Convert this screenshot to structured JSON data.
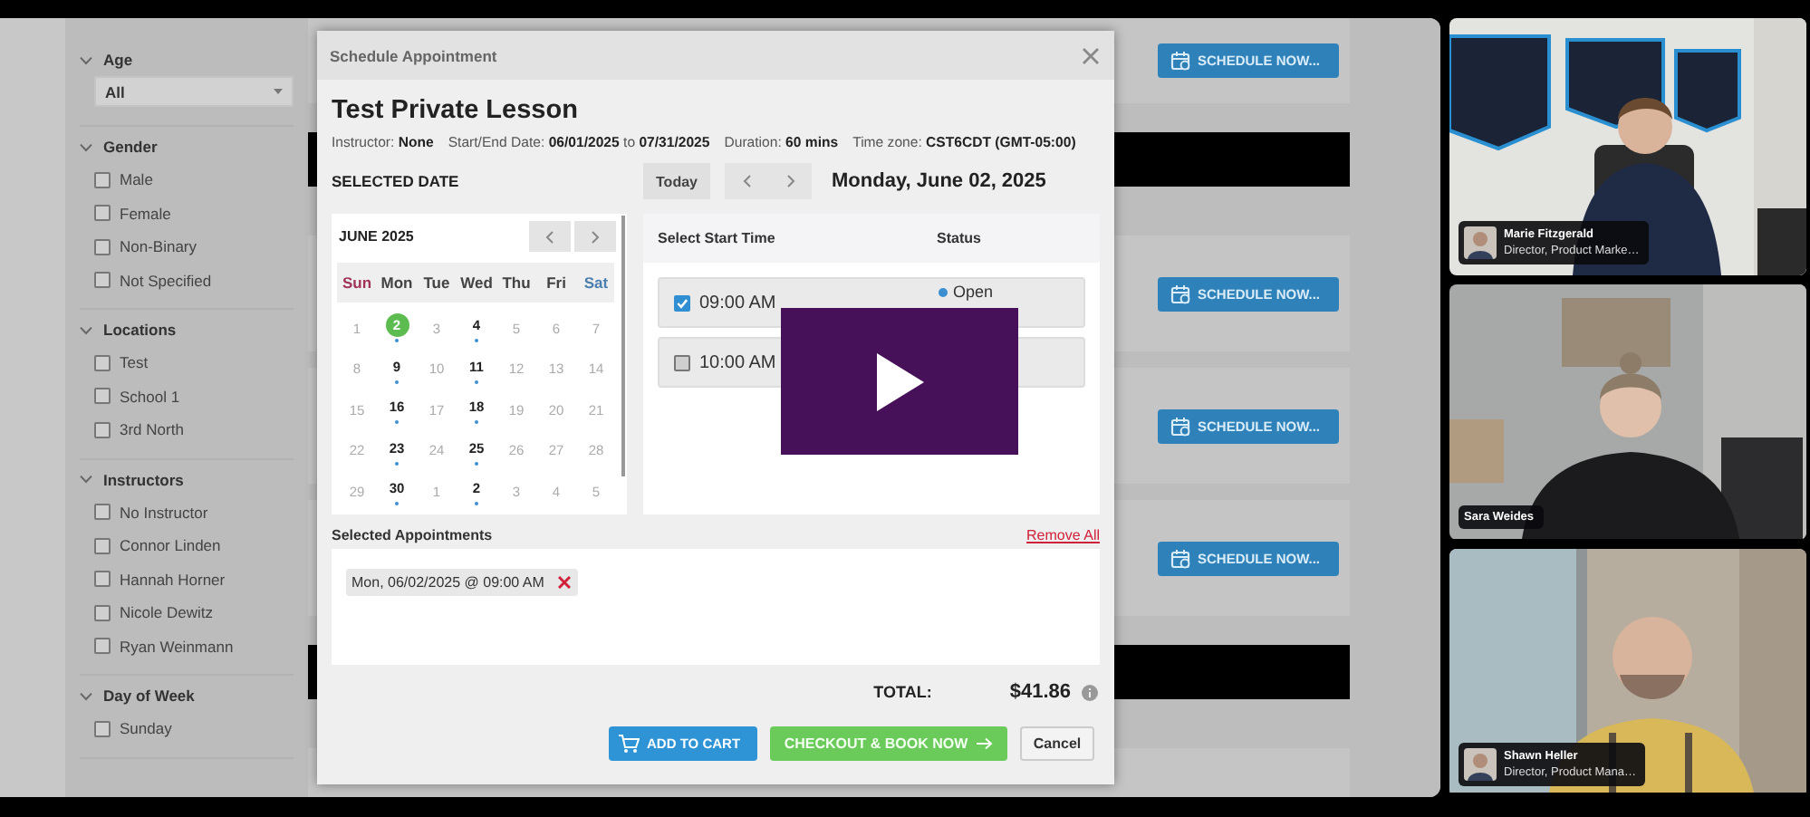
{
  "sidebar": {
    "sections": [
      {
        "title": "Age",
        "expanded": true,
        "kind": "select",
        "value": "All"
      },
      {
        "title": "Gender",
        "expanded": true,
        "kind": "checklist",
        "items": [
          {
            "label": "Male",
            "checked": false
          },
          {
            "label": "Female",
            "checked": false
          },
          {
            "label": "Non-Binary",
            "checked": false
          },
          {
            "label": "Not Specified",
            "checked": false
          }
        ]
      },
      {
        "title": "Locations",
        "expanded": true,
        "kind": "checklist",
        "items": [
          {
            "label": "Test",
            "checked": false
          },
          {
            "label": "School 1",
            "checked": false
          },
          {
            "label": "3rd North",
            "checked": false
          }
        ]
      },
      {
        "title": "Instructors",
        "expanded": true,
        "kind": "checklist",
        "items": [
          {
            "label": "No Instructor",
            "checked": false
          },
          {
            "label": "Connor Linden",
            "checked": false
          },
          {
            "label": "Hannah Horner",
            "checked": false
          },
          {
            "label": "Nicole Dewitz",
            "checked": false
          },
          {
            "label": "Ryan Weinmann",
            "checked": false
          }
        ]
      },
      {
        "title": "Day of Week",
        "expanded": true,
        "kind": "checklist",
        "items": [
          {
            "label": "Sunday",
            "checked": false
          }
        ]
      }
    ]
  },
  "listings": [
    {
      "kind": "card",
      "button": "SCHEDULE NOW..."
    },
    {
      "kind": "banner"
    },
    {
      "kind": "card",
      "button": "SCHEDULE NOW..."
    },
    {
      "kind": "card",
      "button": "SCHEDULE NOW..."
    },
    {
      "kind": "card",
      "button": "SCHEDULE NOW..."
    },
    {
      "kind": "banner"
    },
    {
      "kind": "card"
    }
  ],
  "dialog": {
    "title": "Schedule Appointment",
    "heading": "Test Private Lesson",
    "details": [
      "Instructor: **None**",
      "Start/End Date: **06/01/2025** to **07/31/2025**",
      "Duration: **60 mins**",
      "Time zone: **CST6CDT (GMT-05:00)**"
    ],
    "date_label": "SELECTED DATE",
    "today": "Today",
    "date": "Monday, June 02, 2025",
    "calendar": {
      "month": "JUNE 2025",
      "weekdays": [
        {
          "label": "Sun",
          "color": "#a0345a"
        },
        {
          "label": "Mon",
          "color": "#444444"
        },
        {
          "label": "Tue",
          "color": "#444444"
        },
        {
          "label": "Wed",
          "color": "#444444"
        },
        {
          "label": "Thu",
          "color": "#444444"
        },
        {
          "label": "Fri",
          "color": "#444444"
        },
        {
          "label": "Sat",
          "color": "#4a7fb0"
        }
      ],
      "days": [
        {
          "label": "1",
          "available": false,
          "selected": false
        },
        {
          "label": "2",
          "available": true,
          "selected": true
        },
        {
          "label": "3",
          "available": false,
          "selected": false
        },
        {
          "label": "4",
          "available": true,
          "selected": false
        },
        {
          "label": "5",
          "available": false,
          "selected": false
        },
        {
          "label": "6",
          "available": false,
          "selected": false
        },
        {
          "label": "7",
          "available": false,
          "selected": false
        },
        {
          "label": "8",
          "available": false,
          "selected": false
        },
        {
          "label": "9",
          "available": true,
          "selected": false
        },
        {
          "label": "10",
          "available": false,
          "selected": false
        },
        {
          "label": "11",
          "available": true,
          "selected": false
        },
        {
          "label": "12",
          "available": false,
          "selected": false
        },
        {
          "label": "13",
          "available": false,
          "selected": false
        },
        {
          "label": "14",
          "available": false,
          "selected": false
        },
        {
          "label": "15",
          "available": false,
          "selected": false
        },
        {
          "label": "16",
          "available": true,
          "selected": false
        },
        {
          "label": "17",
          "available": false,
          "selected": false
        },
        {
          "label": "18",
          "available": true,
          "selected": false
        },
        {
          "label": "19",
          "available": false,
          "selected": false
        },
        {
          "label": "20",
          "available": false,
          "selected": false
        },
        {
          "label": "21",
          "available": false,
          "selected": false
        },
        {
          "label": "22",
          "available": false,
          "selected": false
        },
        {
          "label": "23",
          "available": true,
          "selected": false
        },
        {
          "label": "24",
          "available": false,
          "selected": false
        },
        {
          "label": "25",
          "available": true,
          "selected": false
        },
        {
          "label": "26",
          "available": false,
          "selected": false
        },
        {
          "label": "27",
          "available": false,
          "selected": false
        },
        {
          "label": "28",
          "available": false,
          "selected": false
        },
        {
          "label": "29",
          "available": false,
          "selected": false
        },
        {
          "label": "30",
          "available": true,
          "selected": false
        },
        {
          "label": "1",
          "available": false,
          "selected": false
        },
        {
          "label": "2",
          "available": true,
          "selected": false
        },
        {
          "label": "3",
          "available": false,
          "selected": false
        },
        {
          "label": "4",
          "available": false,
          "selected": false
        },
        {
          "label": "5",
          "available": false,
          "selected": false
        }
      ]
    },
    "times": {
      "columns": [
        "Select Start Time",
        "Status"
      ],
      "slots": [
        {
          "time": "09:00 AM",
          "checked": true,
          "status": "Open",
          "color": "#3a8fd0"
        },
        {
          "time": "10:00 AM",
          "checked": false
        }
      ]
    },
    "selected_label": "Selected Appointments",
    "remove_all": "Remove All",
    "appointments": [
      "Mon, 06/02/2025 @ 09:00 AM"
    ],
    "total_label": "TOTAL:",
    "total": "$41.86",
    "buttons": [
      {
        "label": "ADD TO CART",
        "kind": "cart"
      },
      {
        "label": "CHECKOUT & BOOK NOW",
        "kind": "checkout"
      },
      {
        "label": "Cancel",
        "kind": "cancel"
      }
    ]
  },
  "participants": [
    {
      "name": "Marie Fitzgerald",
      "title": "Director, Product Marke…",
      "avatar": true
    },
    {
      "name": "Sara Weides",
      "avatar": false
    },
    {
      "name": "Shawn Heller",
      "title": "Director, Product Mana…",
      "avatar": true
    }
  ]
}
